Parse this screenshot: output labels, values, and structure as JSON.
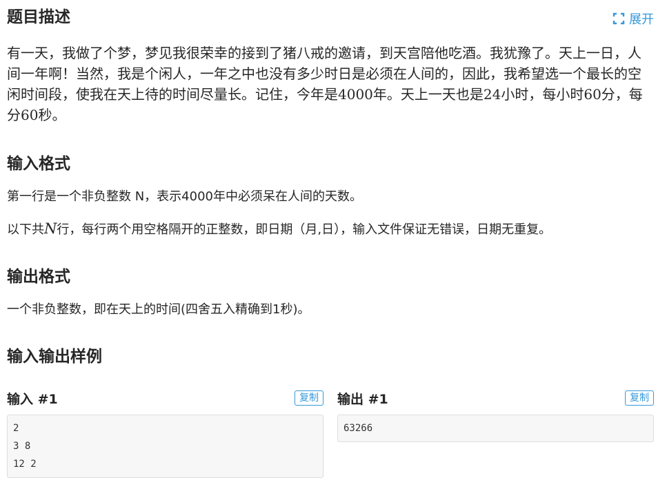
{
  "problem": {
    "description_title": "题目描述",
    "expand_label": "展开",
    "description": "有一天，我做了个梦，梦见我很荣幸的接到了猪八戒的邀请，到天宫陪他吃酒。我犹豫了。天上一日，人间一年啊！当然，我是个闲人，一年之中也没有多少时日是必须在人间的，因此，我希望选一个最长的空闲时间段，使我在天上待的时间尽量长。记住，今年是4000年。天上一天也是24小时，每小时60分，每分60秒。",
    "input_format_title": "输入格式",
    "input_line1": "第一行是一个非负整数 N，表示4000年中必须呆在人间的天数。",
    "input_line2_pre": "以下共",
    "input_line2_var": "N",
    "input_line2_post": "行，每行两个用空格隔开的正整数，即日期（月,日），输入文件保证无错误，日期无重复。",
    "output_format_title": "输出格式",
    "output_line": "一个非负整数，即在天上的时间(四舍五入精确到1秒)。",
    "samples_title": "输入输出样例"
  },
  "samples": {
    "input_label": "输入 #1",
    "output_label": "输出 #1",
    "copy_label": "复制",
    "input_lines": [
      "2",
      "3 8",
      "12 2"
    ],
    "output_lines": [
      "63266"
    ]
  },
  "colors": {
    "accent": "#3498db",
    "code_bg": "#f7f7f7"
  }
}
